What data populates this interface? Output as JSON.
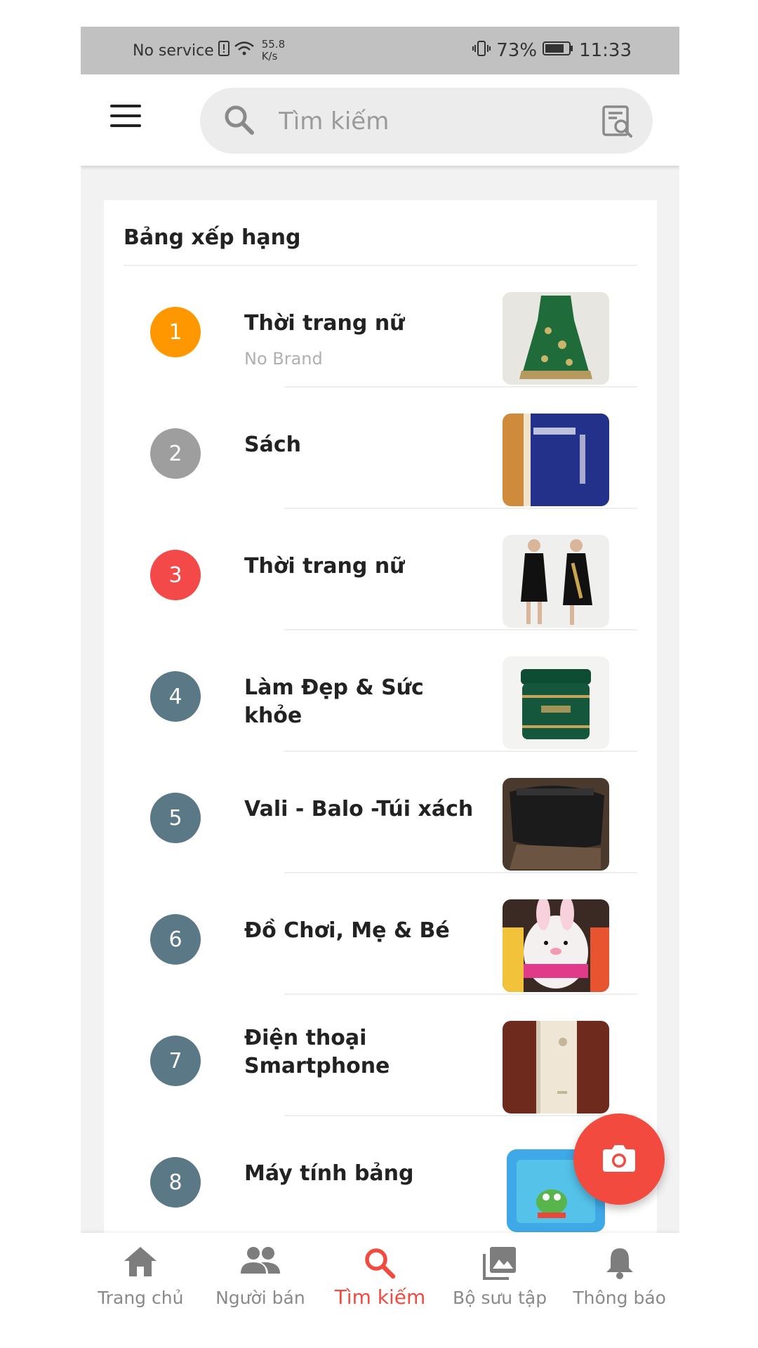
{
  "status_bar": {
    "carrier": "No service",
    "speed_value": "55.8",
    "speed_unit": "K/s",
    "battery_percent": "73%",
    "time": "11:33"
  },
  "header": {
    "menu_icon": "hamburger-icon",
    "search_placeholder": "Tìm kiếm",
    "scan_icon": "image-search-icon"
  },
  "ranking": {
    "title": "Bảng xếp hạng",
    "items": [
      {
        "rank": "1",
        "title": "Thời trang nữ",
        "subtitle": "No Brand",
        "badge_color": "#ff9800",
        "thumb": "green-dress-photo"
      },
      {
        "rank": "2",
        "title": "Sách",
        "subtitle": "",
        "badge_color": "#9e9e9e",
        "thumb": "book-cover-photo"
      },
      {
        "rank": "3",
        "title": "Thời trang nữ",
        "subtitle": "",
        "badge_color": "#f44949",
        "thumb": "black-dress-photo"
      },
      {
        "rank": "4",
        "title": "Làm Đẹp & Sức khỏe",
        "subtitle": "",
        "badge_color": "#5b7887",
        "thumb": "cream-jar-photo"
      },
      {
        "rank": "5",
        "title": "Vali - Balo -Túi xách",
        "subtitle": "",
        "badge_color": "#5b7887",
        "thumb": "black-bag-photo"
      },
      {
        "rank": "6",
        "title": "Đồ Chơi, Mẹ & Bé",
        "subtitle": "",
        "badge_color": "#5b7887",
        "thumb": "plush-toy-photo"
      },
      {
        "rank": "7",
        "title": "Điện thoại Smartphone",
        "subtitle": "",
        "badge_color": "#5b7887",
        "thumb": "iphone-photo"
      },
      {
        "rank": "8",
        "title": "Máy tính bảng",
        "subtitle": "",
        "badge_color": "#5b7887",
        "thumb": "kids-tablet-photo"
      }
    ]
  },
  "fab": {
    "icon": "camera-icon",
    "color": "#f24a3e"
  },
  "bottom_nav": {
    "items": [
      {
        "label": "Trang chủ",
        "icon": "home-icon"
      },
      {
        "label": "Người bán",
        "icon": "people-icon"
      },
      {
        "label": "Tìm kiếm",
        "icon": "search-icon",
        "active": true
      },
      {
        "label": "Bộ sưu tập",
        "icon": "collection-icon"
      },
      {
        "label": "Thông báo",
        "icon": "bell-icon"
      }
    ],
    "active_color": "#f24a3e"
  }
}
